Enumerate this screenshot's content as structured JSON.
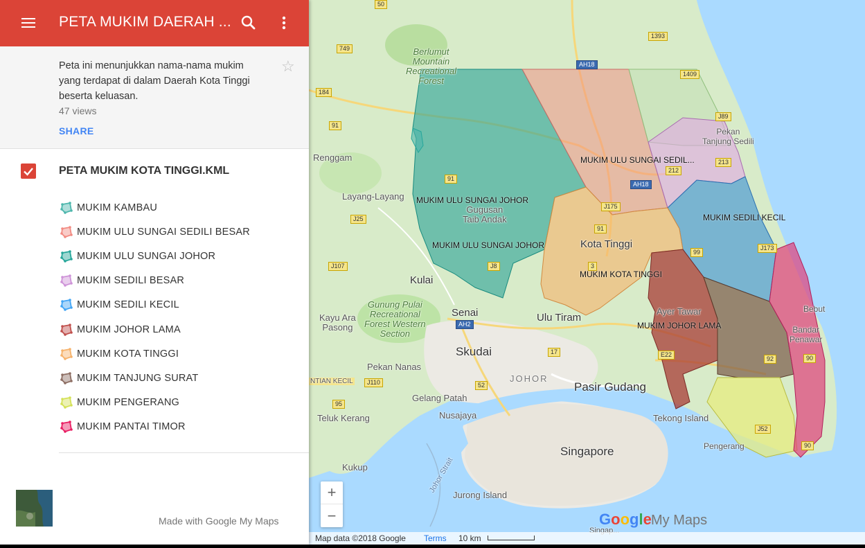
{
  "appbar": {
    "title": "PETA MUKIM DAERAH ..."
  },
  "description": {
    "text": "Peta ini menunjukkan nama-nama mukim yang terdapat di dalam Daerah Kota Tinggi beserta keluasan.",
    "views": "47 views",
    "share_label": "SHARE"
  },
  "layer": {
    "title": "PETA MUKIM KOTA TINGGI.KML",
    "checked": true,
    "items": [
      {
        "label": "MUKIM KAMBAU",
        "color": "#4db6ac"
      },
      {
        "label": "MUKIM ULU SUNGAI SEDILI BESAR",
        "color": "#f28b82"
      },
      {
        "label": "MUKIM ULU SUNGAI JOHOR",
        "color": "#26a69a"
      },
      {
        "label": "MUKIM SEDILI BESAR",
        "color": "#ce93d8"
      },
      {
        "label": "MUKIM SEDILI KECIL",
        "color": "#42a5f5"
      },
      {
        "label": "MUKIM JOHOR LAMA",
        "color": "#c0504d"
      },
      {
        "label": "MUKIM KOTA TINGGI",
        "color": "#f6b26b"
      },
      {
        "label": "MUKIM TANJUNG SURAT",
        "color": "#8d6e63"
      },
      {
        "label": "MUKIM PENGERANG",
        "color": "#d4e157"
      },
      {
        "label": "MUKIM PANTAI TIMOR",
        "color": "#e91e63"
      }
    ]
  },
  "footer": {
    "made_with": "Made with Google My Maps"
  },
  "map": {
    "mukim_labels": {
      "ulu_sungai_sedili": "MUKIM ULU SUNGAI SEDIL...",
      "ulu_sungai_johor_1": "MUKIM ULU SUNGAI JOHOR",
      "ulu_sungai_johor_2": "MUKIM ULU SUNGAI JOHOR",
      "sedili_kecil": "MUKIM SEDILI KECIL",
      "kota_tinggi": "MUKIM KOTA TINGGI",
      "johor_lama": "MUKIM JOHOR LAMA"
    },
    "places": {
      "berlumut": "Berlumut\nMountain\nRecreational\nForest",
      "renggam": "Renggam",
      "layang": "Layang-Layang",
      "gugusan": "Gugusan\nTaib Andak",
      "kota_tinggi": "Kota Tinggi",
      "kulai": "Kulai",
      "gunung_pulai": "Gunung Pulai\nRecreational\nForest Western\nSection",
      "senai": "Senai",
      "ulu_tiram": "Ulu Tiram",
      "kayu_ara": "Kayu Ara\nPasong",
      "skudai": "Skudai",
      "pekan_nanas": "Pekan Nanas",
      "johor": "JOHOR",
      "pasir_gudang": "Pasir Gudang",
      "gelang_patah": "Gelang Patah",
      "nusajaya": "Nusajaya",
      "teluk_kerang": "Teluk Kerang",
      "tekong": "Tekong Island",
      "pengerang": "Pengerang",
      "singapore": "Singapore",
      "kukup": "Kukup",
      "johor_strait": "Johor Strait",
      "jurong": "Jurong Island",
      "pekan_tanjung": "Pekan\nTanjung Sedili",
      "ayer_tawar": "Ayer Tawar",
      "bebut": "Bebut",
      "bandar_penawar": "Bandar\nPenawar",
      "sinapore2": "Singap...",
      "ntian_kecil": "NTIAN KECIL"
    },
    "roads": [
      "50",
      "1393",
      "749",
      "AH18",
      "1409",
      "184",
      "J89",
      "91",
      "212",
      "213",
      "91",
      "AH18",
      "J25",
      "J175",
      "J173",
      "91",
      "J107",
      "J8",
      "3",
      "99",
      "AH2",
      "17",
      "E22",
      "92",
      "90",
      "J110",
      "52",
      "95",
      "J52",
      "90"
    ],
    "zoom_in": "+",
    "zoom_out": "−",
    "google": "Google",
    "mymaps": "My Maps",
    "attribution": "Map data ©2018 Google",
    "terms": "Terms",
    "scale": "10 km"
  }
}
